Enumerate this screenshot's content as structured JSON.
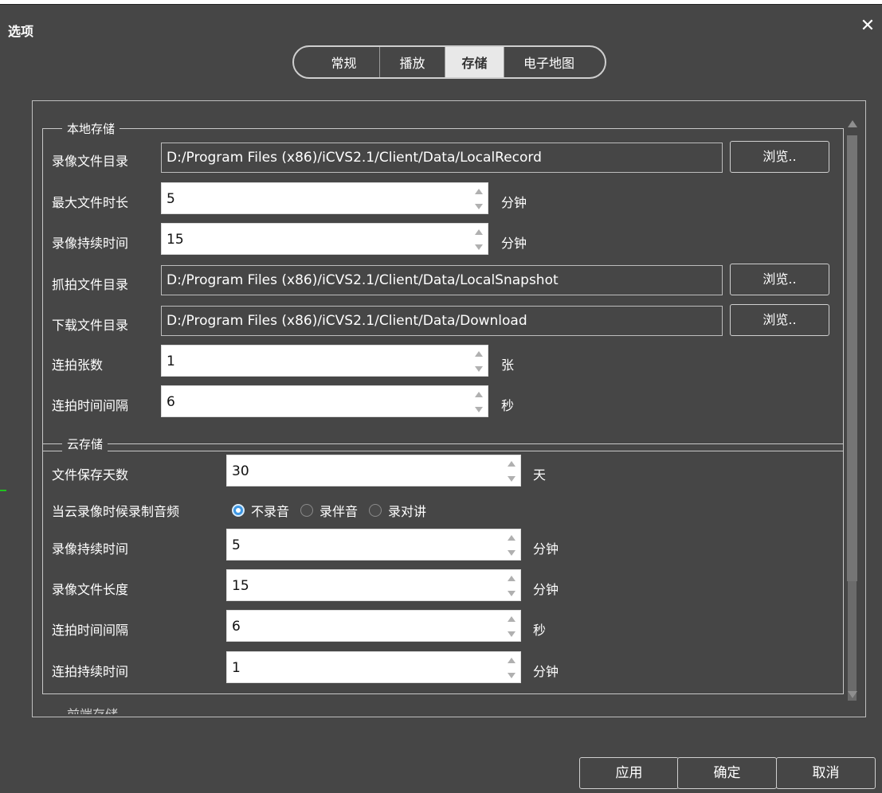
{
  "dialog": {
    "title": "选项",
    "close_glyph": "✕"
  },
  "tabs": [
    {
      "label": "常规"
    },
    {
      "label": "播放"
    },
    {
      "label": "存储"
    },
    {
      "label": "电子地图"
    }
  ],
  "local_storage": {
    "group_title": "本地存储",
    "record_dir": {
      "label": "录像文件目录",
      "value": "D:/Program Files (x86)/iCVS2.1/Client/Data/LocalRecord",
      "browse": "浏览.."
    },
    "max_file_duration": {
      "label": "最大文件时长",
      "value": "5",
      "unit": "分钟"
    },
    "record_duration": {
      "label": "录像持续时间",
      "value": "15",
      "unit": "分钟"
    },
    "snapshot_dir": {
      "label": "抓拍文件目录",
      "value": "D:/Program Files (x86)/iCVS2.1/Client/Data/LocalSnapshot",
      "browse": "浏览.."
    },
    "download_dir": {
      "label": "下载文件目录",
      "value": "D:/Program Files (x86)/iCVS2.1/Client/Data/Download",
      "browse": "浏览.."
    },
    "burst_count": {
      "label": "连拍张数",
      "value": "1",
      "unit": "张"
    },
    "burst_interval": {
      "label": "连拍时间间隔",
      "value": "6",
      "unit": "秒"
    }
  },
  "cloud_storage": {
    "group_title": "云存储",
    "retention_days": {
      "label": "文件保存天数",
      "value": "30",
      "unit": "天"
    },
    "audio_option": {
      "label": "当云录像时候录制音频",
      "options": [
        "不录音",
        "录伴音",
        "录对讲"
      ],
      "selected": "不录音"
    },
    "record_duration": {
      "label": "录像持续时间",
      "value": "5",
      "unit": "分钟"
    },
    "record_file_length": {
      "label": "录像文件长度",
      "value": "15",
      "unit": "分钟"
    },
    "burst_interval": {
      "label": "连拍时间间隔",
      "value": "6",
      "unit": "秒"
    },
    "burst_duration": {
      "label": "连拍持续时间",
      "value": "1",
      "unit": "分钟"
    }
  },
  "next_group_cut_label": "前端存储",
  "footer": {
    "apply": "应用",
    "ok": "确定",
    "cancel": "取消"
  },
  "colors": {
    "background": "#464646",
    "radio_selected": "#3d97e4",
    "active_tab": "#e8e8e8"
  },
  "icons": {
    "close": "close-icon",
    "spin_up": "chevron-up-icon",
    "spin_down": "chevron-down-icon"
  }
}
